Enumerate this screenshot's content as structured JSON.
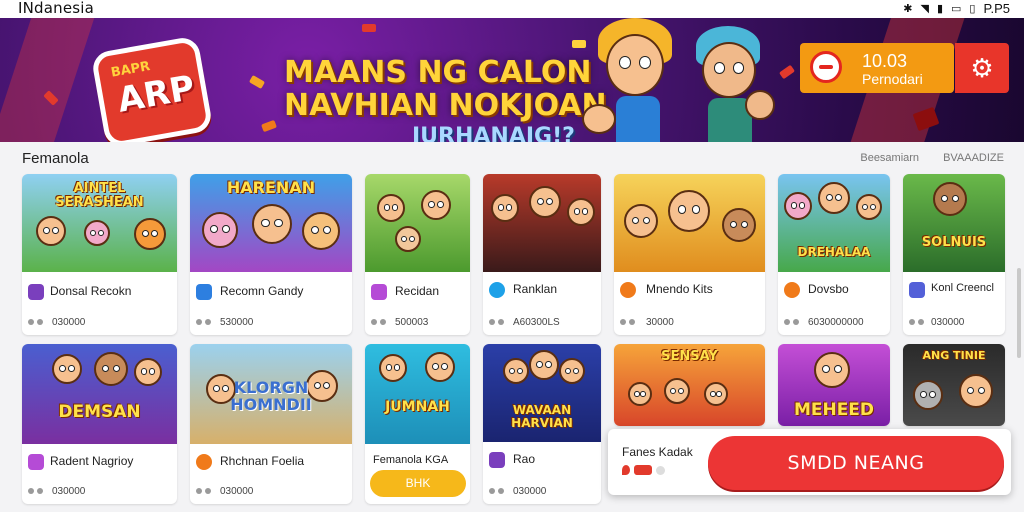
{
  "status_bar": {
    "title": "INdanesia",
    "right_text": "P.P5"
  },
  "banner": {
    "logo": "ARP",
    "logo_small": "BAPR",
    "headline": [
      "MAANS NG CALON",
      "NAVHIAN NOKJOAN",
      "JURHANAIG!?"
    ],
    "promo_value": "10.03",
    "promo_label": "Pernodari"
  },
  "section": {
    "title": "Femanola",
    "link_1": "Beesamiarn",
    "link_2": "BVAAADIZE"
  },
  "cards_row1": [
    {
      "art": "AINTEL SERASHEAN",
      "name": "Donsal Recokn",
      "meta": "030000",
      "icon": "#7a3fbd"
    },
    {
      "art": "HARENAN",
      "name": "Recomn Gandy",
      "meta": "530000",
      "icon": "#2d7fe0"
    },
    {
      "art": "",
      "name": "Recidan",
      "meta": "500003",
      "icon": "#b54bd6"
    },
    {
      "art": "",
      "name": "Ranklan",
      "meta": "A60300LS",
      "icon": "#1ea1e8"
    },
    {
      "art": "",
      "name": "Mnendo Kits",
      "meta": "30000",
      "icon": "#f07a1a"
    },
    {
      "art": "DREHALAA",
      "name": "Dovsbo",
      "meta": "6030000000",
      "icon": "#f07a1a"
    },
    {
      "art": "SOLNUIS",
      "name": "Konl Creencl",
      "meta": "030000",
      "icon": "#5360d8"
    }
  ],
  "cards_row2": [
    {
      "art": "DEMSAN",
      "name": "Radent Nagrioy",
      "meta": "030000",
      "icon": "#b54bd6"
    },
    {
      "art": "KLORGN HOMNDII",
      "name": "Rhchnan Foelia",
      "meta": "030000",
      "icon": "#f07a1a"
    },
    {
      "art": "JUMNAH",
      "name": "Femanola KGA",
      "meta": "",
      "icon": "#1ea1e8",
      "button": "BHK"
    },
    {
      "art": "WAVAAN HARVIAN",
      "name": "Rao",
      "meta": "030000",
      "icon": "#7a3fbd"
    },
    {
      "art": "SENSAY",
      "name": "",
      "meta": "",
      "icon": "#f07a1a"
    },
    {
      "art": "MEHEED",
      "name": "",
      "meta": "",
      "icon": "#e8352a"
    },
    {
      "art": "ANG TINIE",
      "name": "",
      "meta": "",
      "icon": "#333"
    }
  ],
  "toast": {
    "name": "Fanes Kadak",
    "cta": "SMDD NEANG"
  },
  "colors": {
    "accent_red": "#ec3535",
    "promo_orange": "#f39a12",
    "banner_purple": "#4a1574"
  }
}
